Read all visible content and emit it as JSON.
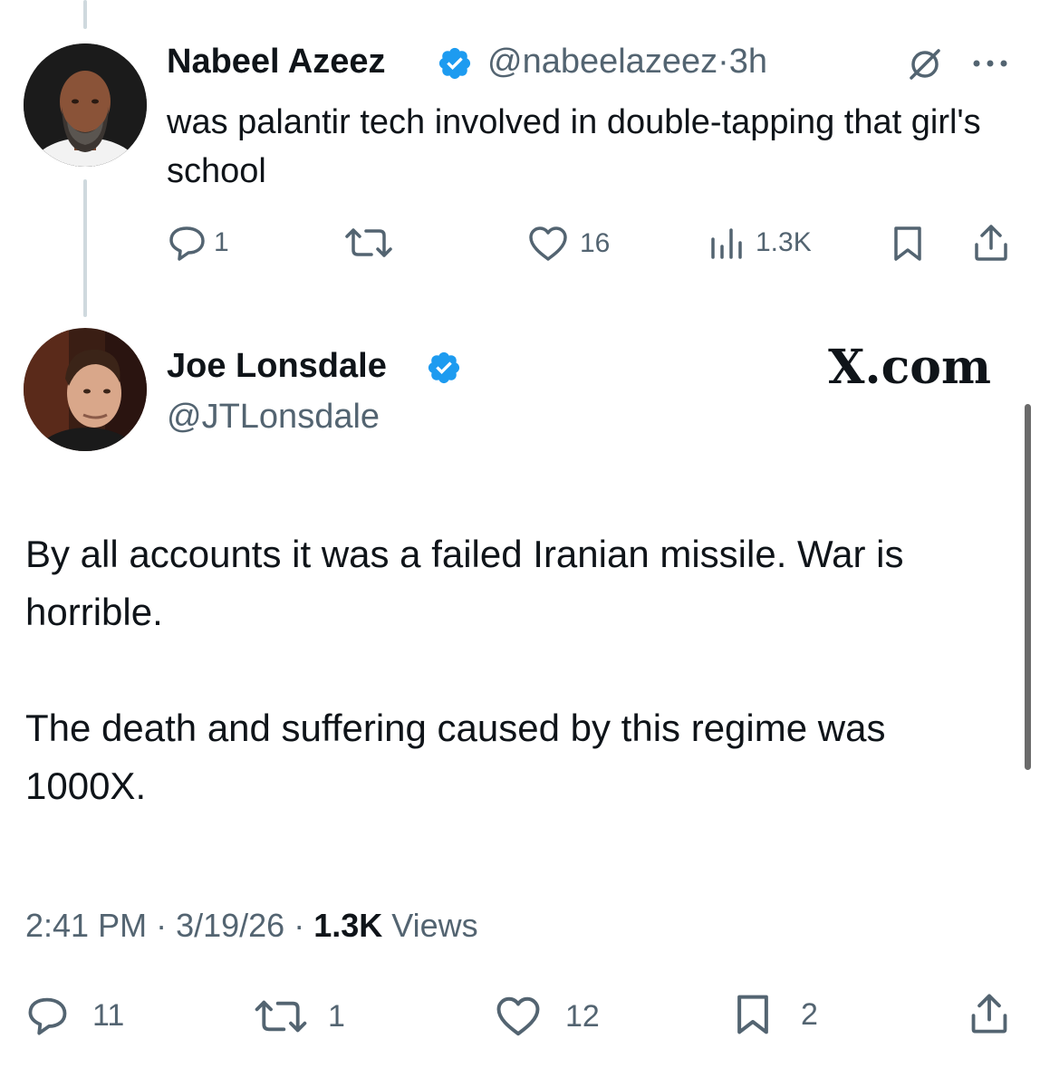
{
  "reply": {
    "author_name": "Nabeel Azeez",
    "handle": "@nabeelazeez",
    "separator": "·",
    "time": "3h",
    "text": "was palantir tech involved in double-tapping that girl's school",
    "actions": {
      "replies": "1",
      "reposts": "",
      "likes": "16",
      "views": "1.3K"
    }
  },
  "main": {
    "author_name": "Joe Lonsdale",
    "handle": "@JTLonsdale",
    "brand": "X.com",
    "paragraph1": "By all accounts it was a failed Iranian missile. War is horrible.",
    "paragraph2": "The death and suffering caused by this regime was 1000X.",
    "meta": {
      "time": "2:41 PM",
      "sep1": " · ",
      "date": "3/19/26",
      "sep2": " · ",
      "views_count": "1.3K",
      "views_label": " Views"
    },
    "actions": {
      "replies": "11",
      "reposts": "1",
      "likes": "12",
      "bookmarks": "2"
    }
  },
  "colors": {
    "verified": "#1d9bf0",
    "text": "#0f1419",
    "secondary": "#536471",
    "thread_line": "#cfd9de"
  }
}
